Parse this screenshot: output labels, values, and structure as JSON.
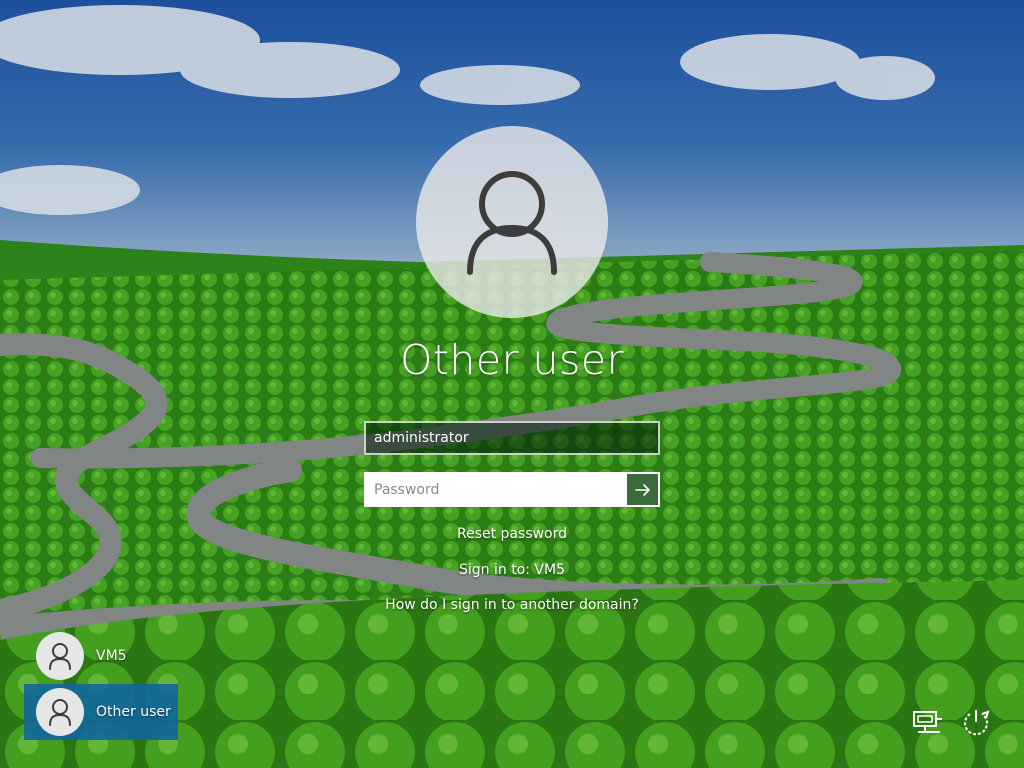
{
  "wallpaper": {
    "sky_color": "#2f63ad",
    "field_color": "#3f9a1f",
    "road_color": "#8a8e8c"
  },
  "login": {
    "avatar_icon": "user-icon",
    "user_name": "Other user",
    "username_value": "administrator",
    "password_placeholder": "Password",
    "submit_icon": "arrow-right-icon",
    "reset_password": "Reset password",
    "sign_in_to": "Sign in to: VM5",
    "other_domain": "How do I sign in to another domain?"
  },
  "user_list": [
    {
      "label": "VM5",
      "icon": "user-icon",
      "selected": false
    },
    {
      "label": "Other user",
      "icon": "user-icon",
      "selected": true
    }
  ],
  "corner_icons": {
    "network": "network-icon",
    "power": "power-icon"
  },
  "colors": {
    "selected_tile": "#1064a0",
    "submit_button": "#3b6b3a"
  }
}
